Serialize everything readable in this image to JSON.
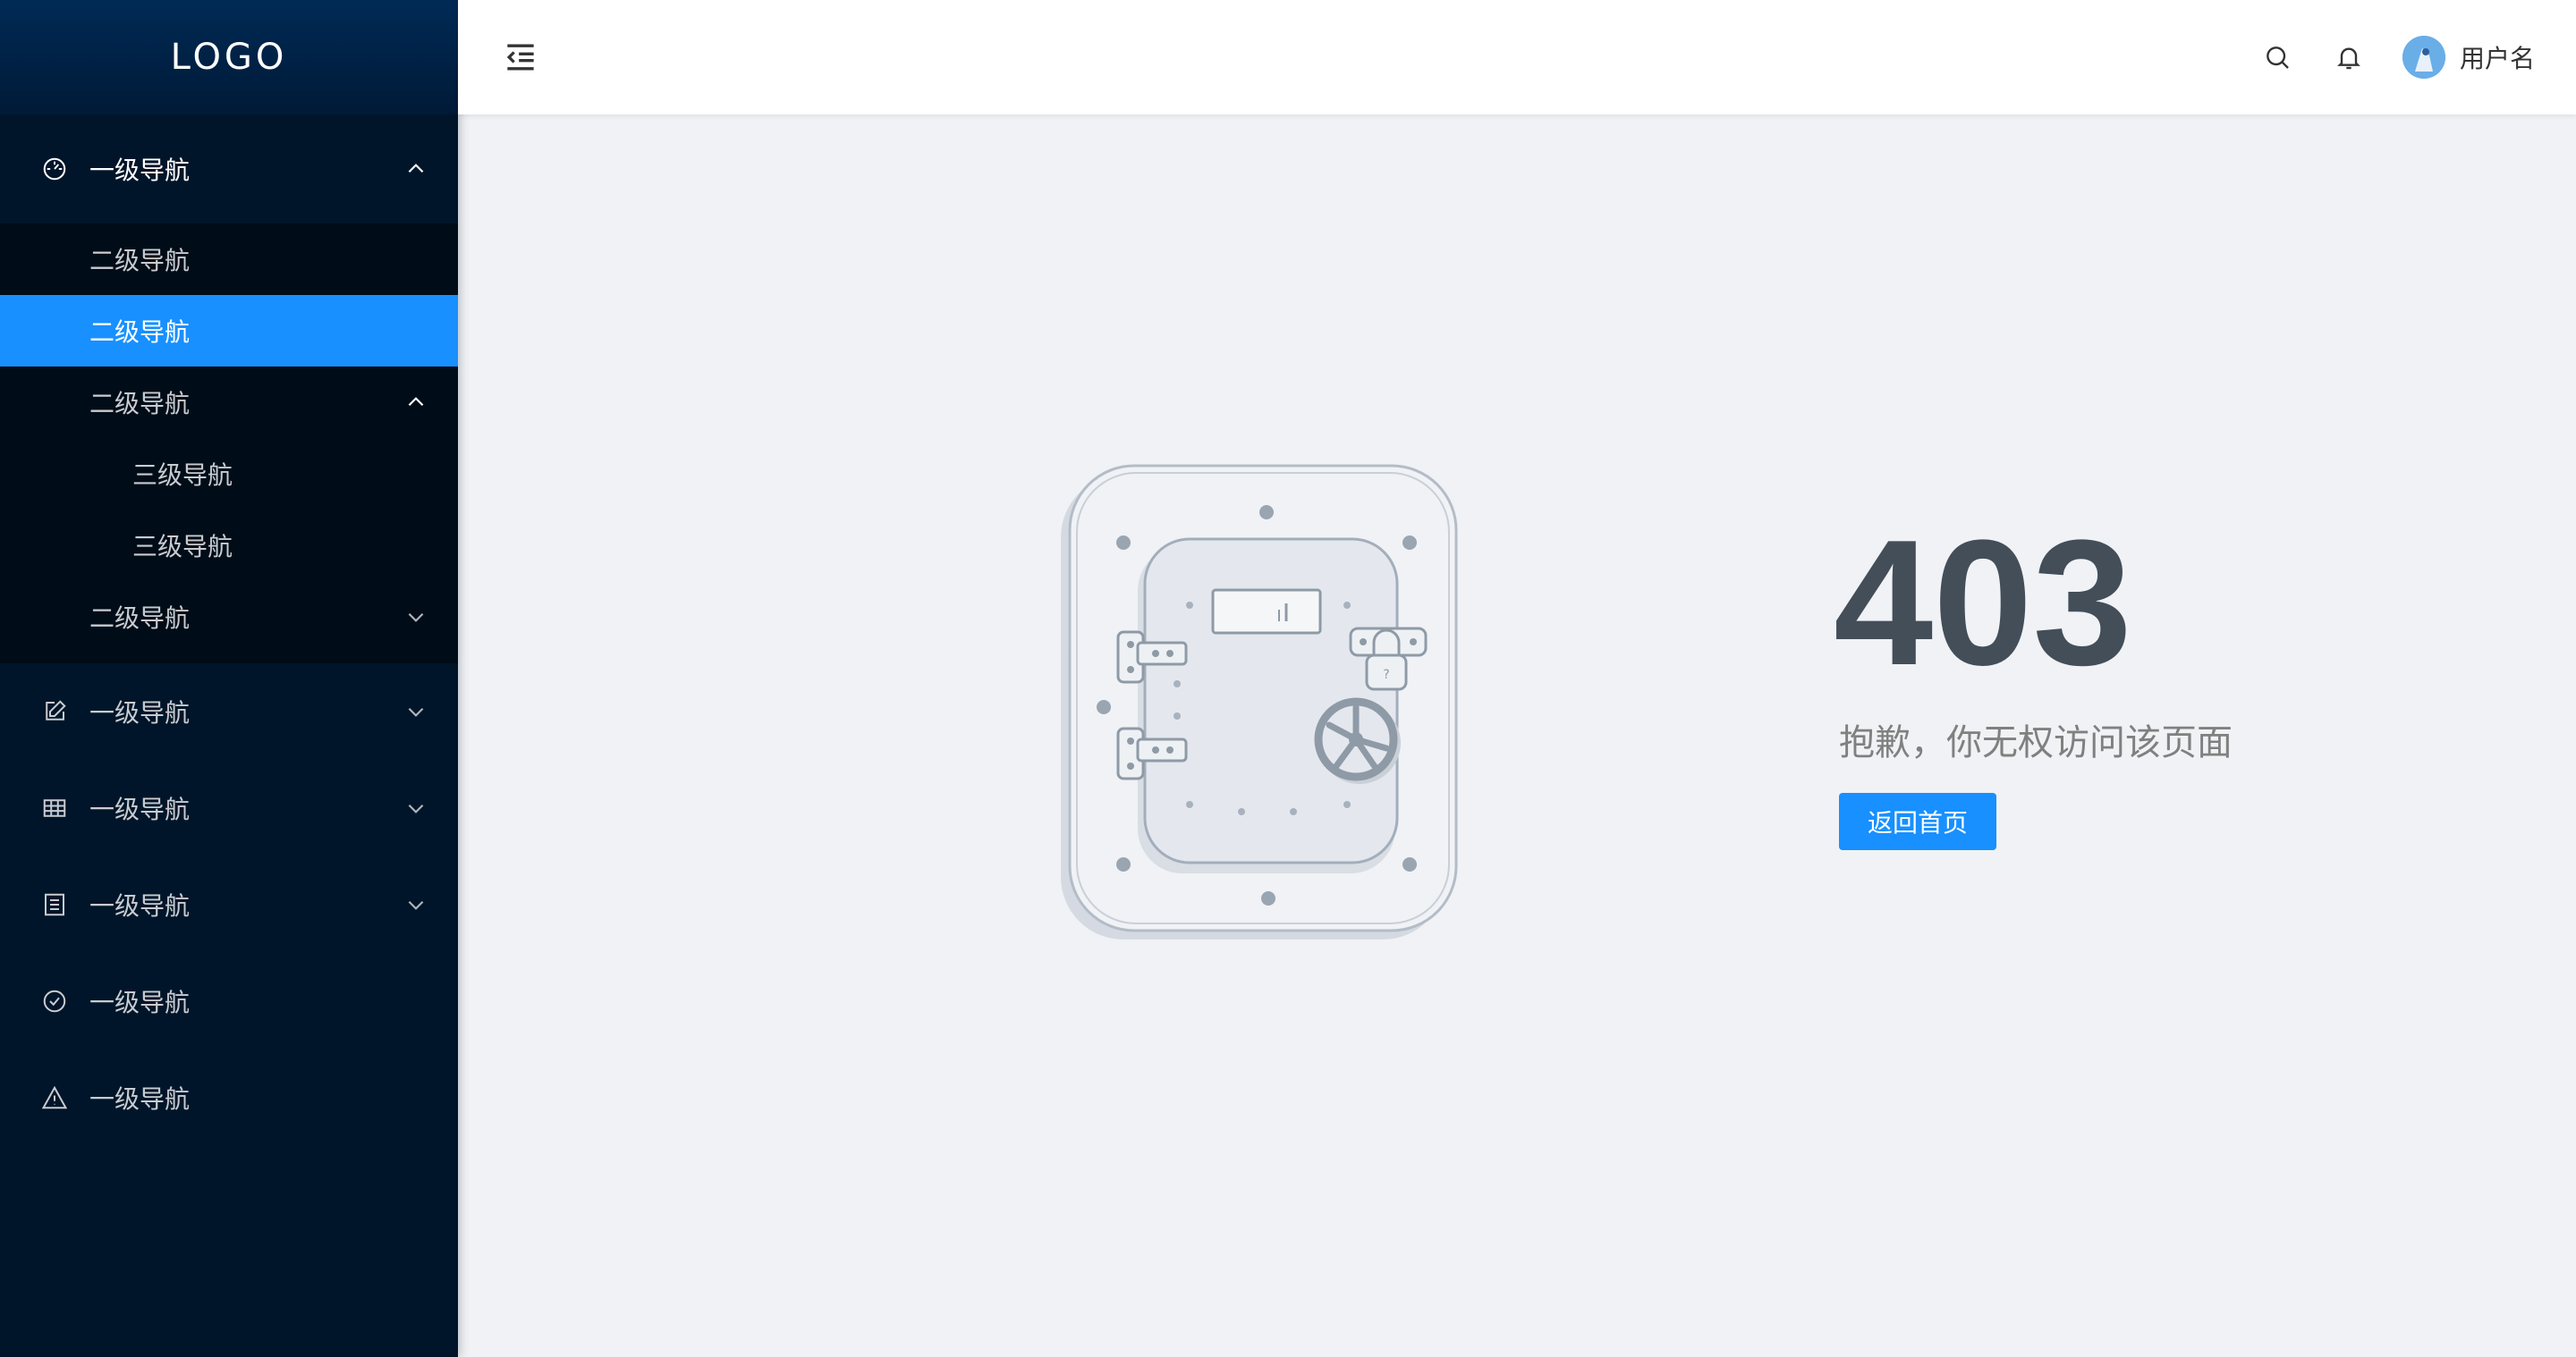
{
  "logo": {
    "text": "LOGO"
  },
  "sidebar": {
    "nav1": {
      "label": "一级导航",
      "icon": "dashboard-icon",
      "expanded": true
    },
    "nav1_children": [
      {
        "label": "二级导航"
      },
      {
        "label": "二级导航",
        "active": true
      },
      {
        "label": "二级导航",
        "expanded": true
      },
      {
        "label": "三级导航"
      },
      {
        "label": "三级导航"
      },
      {
        "label": "二级导航"
      }
    ],
    "items": [
      {
        "label": "一级导航",
        "icon": "edit-icon"
      },
      {
        "label": "一级导航",
        "icon": "table-icon"
      },
      {
        "label": "一级导航",
        "icon": "list-icon"
      },
      {
        "label": "一级导航",
        "icon": "check-circle-icon"
      },
      {
        "label": "一级导航",
        "icon": "warning-icon"
      }
    ]
  },
  "header": {
    "fold_icon": "menu-fold-icon",
    "search_icon": "search-icon",
    "bell_icon": "bell-icon",
    "username": "用户名"
  },
  "error": {
    "code": "403",
    "message": "抱歉，你无权访问该页面",
    "button": "返回首页"
  },
  "colors": {
    "sidebar_bg": "#001529",
    "submenu_bg": "#000c17",
    "accent": "#1890ff",
    "page_bg": "#f0f2f5",
    "code_color": "#434e59"
  }
}
